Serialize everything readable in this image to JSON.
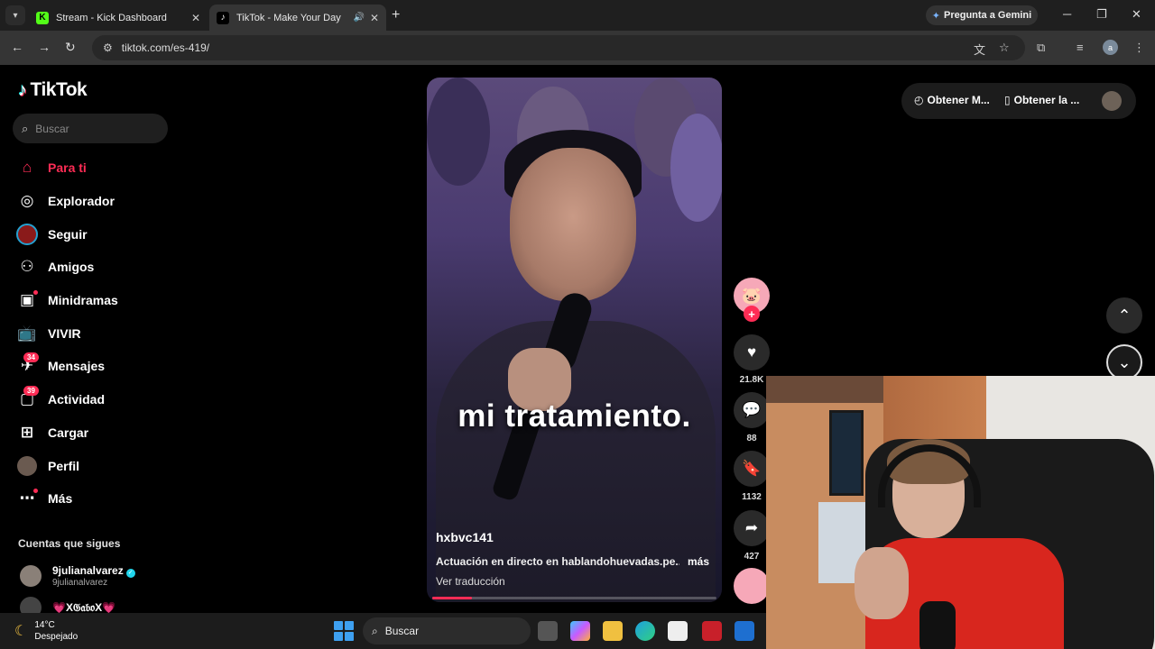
{
  "browser": {
    "tabs": [
      {
        "title": "Stream - Kick Dashboard",
        "favicon": "K",
        "active": false
      },
      {
        "title": "TikTok - Make Your Day",
        "favicon": "♪",
        "active": true
      }
    ],
    "gemini_label": "Pregunta a Gemini",
    "url": "tiktok.com/es-419/"
  },
  "tiktok": {
    "logo": "TikTok",
    "search_placeholder": "Buscar",
    "nav": [
      {
        "label": "Para ti",
        "icon": "home-icon",
        "active": true
      },
      {
        "label": "Explorador",
        "icon": "compass-icon"
      },
      {
        "label": "Seguir",
        "icon": "following-avatar-icon"
      },
      {
        "label": "Amigos",
        "icon": "friends-icon"
      },
      {
        "label": "Minidramas",
        "icon": "film-icon"
      },
      {
        "label": "VIVIR",
        "icon": "live-tv-icon"
      },
      {
        "label": "Mensajes",
        "icon": "messages-icon",
        "badge": "34"
      },
      {
        "label": "Actividad",
        "icon": "activity-icon",
        "badge": "39"
      },
      {
        "label": "Cargar",
        "icon": "upload-icon"
      },
      {
        "label": "Perfil",
        "icon": "profile-avatar-icon"
      },
      {
        "label": "Más",
        "icon": "more-icon"
      }
    ],
    "following_title": "Cuentas que sigues",
    "following": [
      {
        "name": "9julianalvarez",
        "handle": "9julianalvarez",
        "verified": true
      },
      {
        "name": "💗X𝔊𝔞𝔟𝔬X💗",
        "handle": ""
      }
    ],
    "top_right": {
      "get_coins": "Obtener M...",
      "get_app": "Obtener la ..."
    },
    "video": {
      "caption": "mi tratamiento.",
      "username": "hxbvc141",
      "description": "Actuación en directo en hablandohuevadas.pe...",
      "more": "más",
      "translate": "Ver traducción",
      "progress": 0.14
    },
    "actions": {
      "likes": "21.8K",
      "comments": "88",
      "saves": "1132",
      "shares": "427"
    }
  },
  "taskbar": {
    "temperature": "14°C",
    "condition": "Despejado",
    "search_label": "Buscar"
  },
  "colors": {
    "accent": "#fe2c55",
    "background": "#000000"
  }
}
